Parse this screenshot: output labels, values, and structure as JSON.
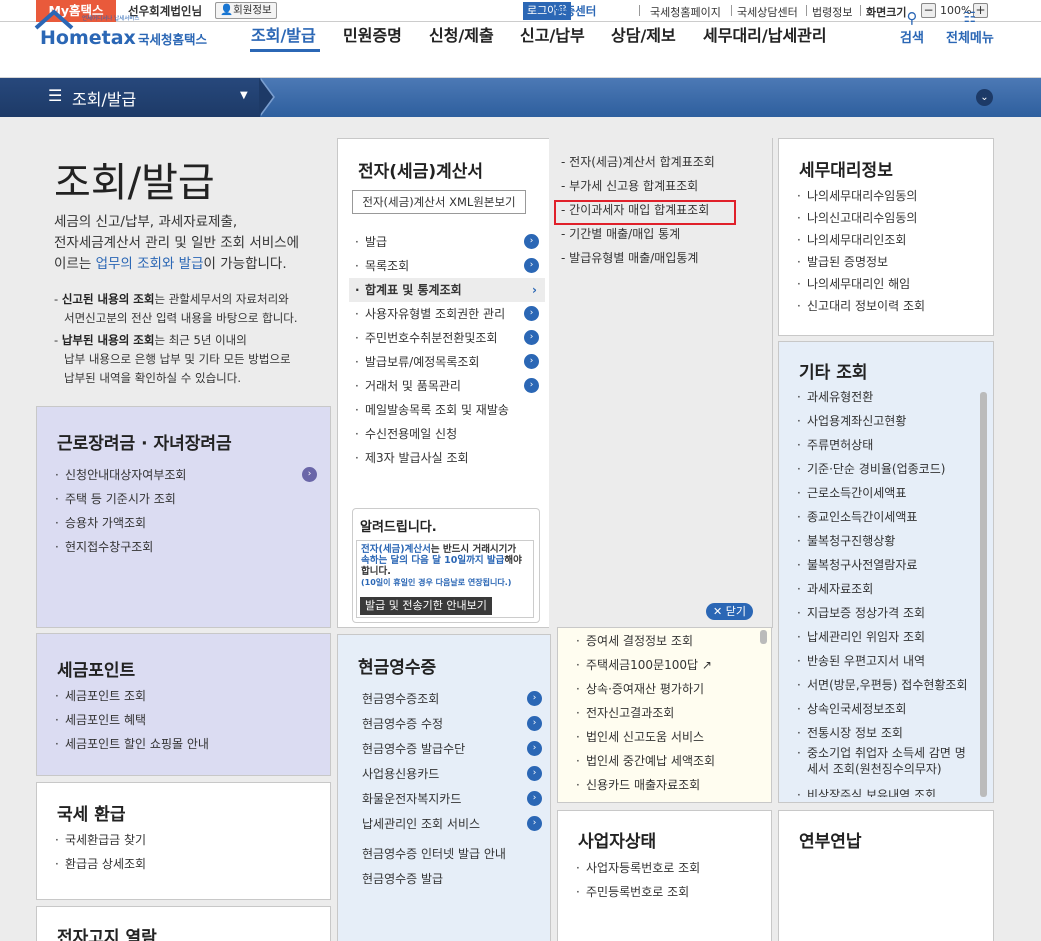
{
  "topbar": {
    "my_home": "My홈택스",
    "welcome": "선우회계법인님",
    "member_info": "회원정보",
    "logout": "로그아웃",
    "cert_center": "인증센터",
    "links": [
      "국세청홈페이지",
      "국세상담센터",
      "법령정보",
      "화면크기"
    ],
    "zoom": "100%"
  },
  "header": {
    "logo_small": "언제어디서나 납세서비스",
    "logo_text": "Hometax",
    "logo_name": "국세청홈택스",
    "nav": [
      "조회/발급",
      "민원증명",
      "신청/제출",
      "신고/납부",
      "상담/제보",
      "세무대리/납세관리"
    ],
    "search": "검색",
    "all_menu": "전체메뉴"
  },
  "crumb": {
    "label": "조회/발급"
  },
  "main": {
    "title": "조회/발급",
    "intro_1": "세금의 신고/납부, 과세자료제출,",
    "intro_2": "전자세금계산서 관리 및 일반 조회 서비스에",
    "intro_3a": "이르는 ",
    "intro_3b": "업무의 조회와 발급",
    "intro_3c": "이 가능합니다.",
    "note1_b": "신고된 내용의 조회",
    "note1_t": "는 관할세무서의 자료처리와",
    "note1_2": "서면신고분의 전산 입력 내용을 바탕으로 합니다.",
    "note2_b": "납부된 내용의 조회",
    "note2_t": "는 최근 5년 이내의",
    "note2_2": "납부 내용으로 은행 납부 및 기타 모든 방법으로",
    "note2_3": "납부된 내역을 확인하실 수 있습니다."
  },
  "geunro": {
    "title": "근로장려금 · 자녀장려금",
    "items": [
      "신청안내대상자여부조회",
      "주택 등 기준시가 조회",
      "승용차 가액조회",
      "현지접수창구조회"
    ]
  },
  "point": {
    "title": "세금포인트",
    "items": [
      "세금포인트 조회",
      "세금포인트 혜택",
      "세금포인트 할인 쇼핑몰 안내"
    ]
  },
  "refund": {
    "title": "국세 환급",
    "items": [
      "국세환급금 찾기",
      "환급금 상세조회"
    ]
  },
  "notice": {
    "title": "전자고지 열람"
  },
  "etax": {
    "title": "전자(세금)계산서",
    "xml_btn": "전자(세금)계산서 XML원본보기",
    "items": [
      "발급",
      "목록조회",
      "합계표 및 통계조회",
      "사용자유형별 조회권한 관리",
      "주민번호수취분전환및조회",
      "발급보류/예정목록조회",
      "거래처 및 품목관리",
      "메일발송목록 조회 및 재발송",
      "수신전용메일 신청",
      "제3자 발급사실 조회"
    ],
    "sub": [
      "전자(세금)계산서 합계표조회",
      "부가세 신고용 합계표조회",
      "간이과세자 매입 합계표조회",
      "기간별 매출/매입 통계",
      "발급유형별 매출/매입통계"
    ],
    "alert_title": "알려드립니다.",
    "alert_1a": "전자(세금)계산서",
    "alert_1b": "는 반드시 거래시기가",
    "alert_2": "속하는 달의 다음 달 10일까지 발급",
    "alert_2b": "해야",
    "alert_3": "합니다.",
    "alert_4": "(10일이 휴일인 경우 다음날로 연장됩니다.)",
    "alert_btn": "발급 및 전송기한 안내보기",
    "close": "닫기"
  },
  "cash": {
    "title": "현금영수증",
    "items": [
      "현금영수증조회",
      "현금영수증 수정",
      "현금영수증 발급수단",
      "사업용신용카드",
      "화물운전자복지카드",
      "납세관리인 조회 서비스",
      "현금영수증 인터넷 발급 안내",
      "현금영수증 발급"
    ]
  },
  "misc2": {
    "items": [
      "증여세 결정정보 조회",
      "주택세금100문100답",
      "상속·증여재산 평가하기",
      "전자신고결과조회",
      "법인세 신고도움 서비스",
      "법인세 중간예납 세액조회",
      "신용카드 매출자료조회"
    ]
  },
  "biz": {
    "title": "사업자상태",
    "items": [
      "사업자등록번호로 조회",
      "주민등록번호로 조회"
    ]
  },
  "tax": {
    "title": "세무대리정보",
    "items": [
      "나의세무대리수임동의",
      "나의신고대리수임동의",
      "나의세무대리인조회",
      "발급된 증명정보",
      "나의세무대리인 해임",
      "신고대리 정보이력 조회"
    ]
  },
  "other": {
    "title": "기타 조회",
    "items": [
      "과세유형전환",
      "사업용계좌신고현황",
      "주류면허상태",
      "기준·단순 경비율(업종코드)",
      "근로소득간이세액표",
      "종교인소득간이세액표",
      "불복청구진행상황",
      "불복청구사전열람자료",
      "과세자료조회",
      "지급보증 정상가격 조회",
      "납세관리인 위임자 조회",
      "반송된 우편고지서 내역",
      "서면(방문,우편등) 접수현황조회",
      "상속인국세정보조회",
      "전통시장 정보 조회",
      "중소기업 취업자 소득세 감면 명",
      "세서 조회(원천징수의무자)",
      "비상장주식 보유내역 조회"
    ]
  },
  "year": {
    "title": "연부연납"
  }
}
